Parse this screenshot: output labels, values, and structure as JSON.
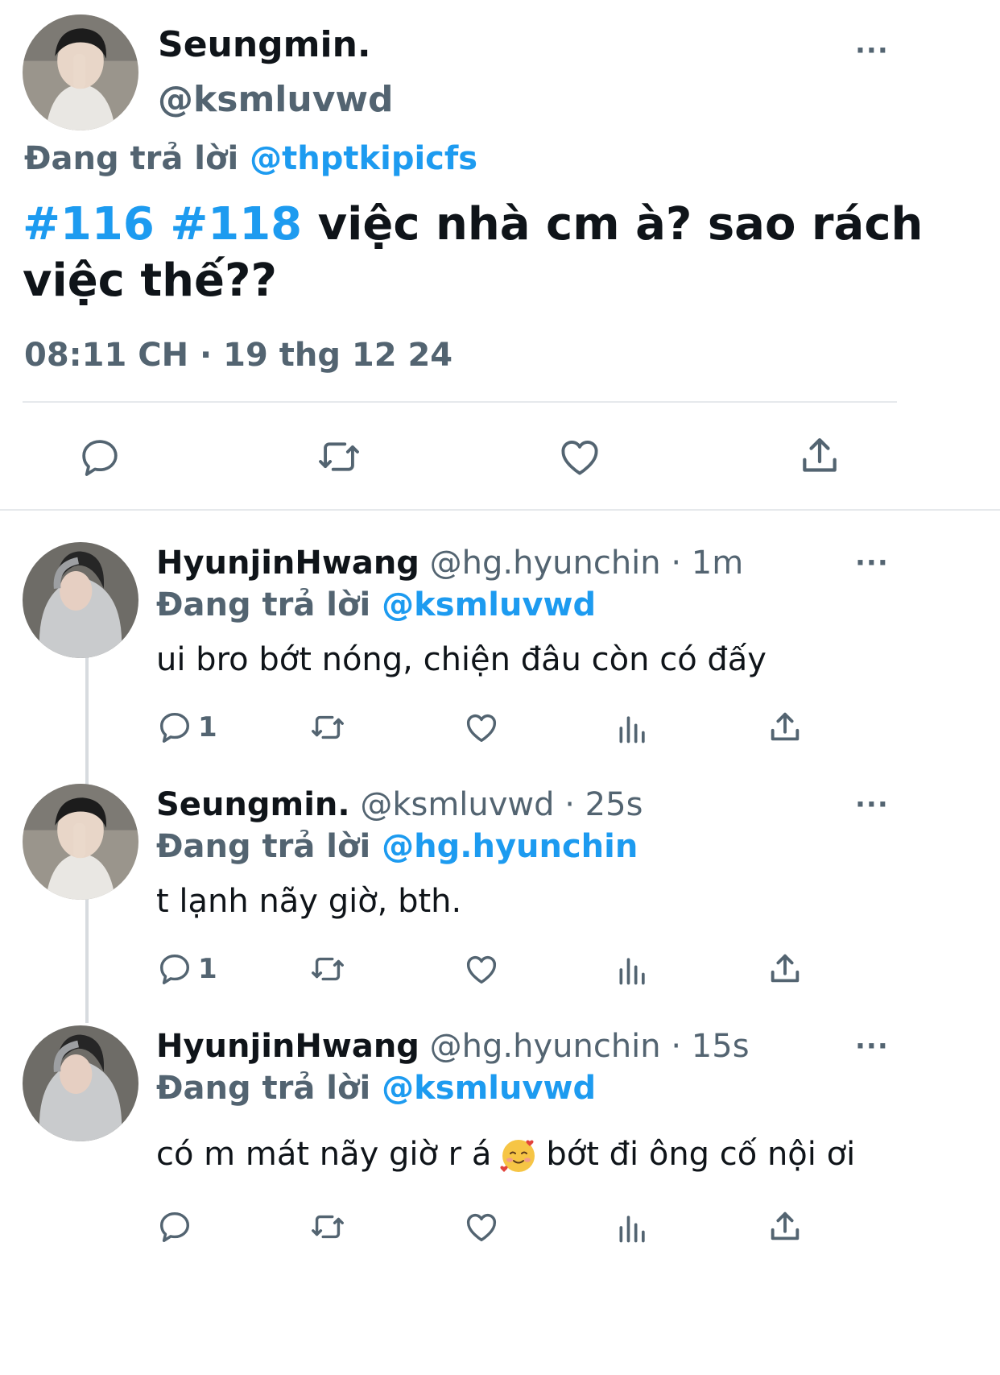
{
  "main_tweet": {
    "author_name": "Seungmin.",
    "handle": "@ksmluvwd",
    "replying_label": "Đang trả lời",
    "replying_to": "@thptkipicfs",
    "hashtags": "#116 #118",
    "text_part1": " việc nhà cm à? sao rách",
    "text_part2": "việc thế??",
    "timestamp": "08:11 CH · 19 thg 12 24",
    "more_label": "···"
  },
  "replies": [
    {
      "author_name": "HyunjinHwang",
      "handle": "@hg.hyunchin",
      "time": "· 1m",
      "replying_label": "Đang trả lời",
      "replying_to": "@ksmluvwd",
      "text": "ui bro bớt nóng, chiện đâu còn có đấy",
      "reply_count": "1",
      "more_label": "···"
    },
    {
      "author_name": "Seungmin.",
      "handle": "@ksmluvwd",
      "time": "· 25s",
      "replying_label": "Đang trả lời",
      "replying_to": "@hg.hyunchin",
      "text": "t lạnh nãy giờ, bth.",
      "reply_count": "1",
      "more_label": "···"
    },
    {
      "author_name": "HyunjinHwang",
      "handle": "@hg.hyunchin",
      "time": "· 15s",
      "replying_label": "Đang trả lời",
      "replying_to": "@ksmluvwd",
      "text_before_emoji": "có m mát nãy giờ r á",
      "emoji": "smiling-face-with-hearts",
      "text_after_emoji": "bớt đi ông cố nội ơi",
      "reply_count": "",
      "more_label": "···"
    }
  ],
  "colors": {
    "accent": "#1d9bf0",
    "secondary_text": "#536471",
    "primary_text": "#0f1419",
    "divider": "#e6e9ec"
  }
}
